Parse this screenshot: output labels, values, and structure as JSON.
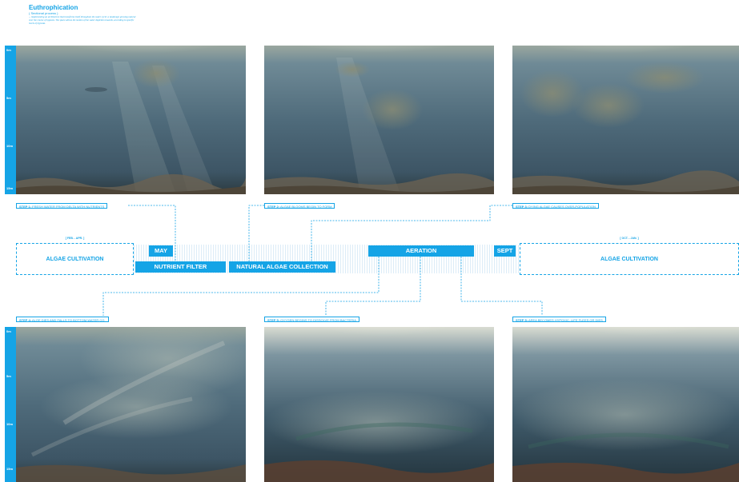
{
  "header": {
    "title": "Euthrophication",
    "subtitle": "( Sectional process )",
    "description": "... implementing an architecture that transforms itself throughout the water cycle: a landscape growing natural over the course of hypoxia. The space allows the motion of the water depletion towards, according to specific levels of hypoxia."
  },
  "depth_labels": [
    "0m",
    "5m",
    "10m",
    "15m"
  ],
  "steps_top": [
    {
      "num": "STEP 1:",
      "text": "FRESH WATER FROM DELTA WITH NUTRIENTS"
    },
    {
      "num": "STEP 2:",
      "text": "ALGAE BLOOMS BEGIN TO FORM"
    },
    {
      "num": "STEP 3:",
      "text": "DYING ALGAE CAUSES OVER-POPULATION"
    }
  ],
  "steps_bottom": [
    {
      "num": "STEP 4:",
      "text": "ALGE DIES AND FALLS TO BOTTOM WATER CO."
    },
    {
      "num": "STEP 5:",
      "text": "OXYGEN BEGINS TO DISSOLVE FROM BACTERIA"
    },
    {
      "num": "STEP 5:",
      "text": "AREA BECOMES HYPOXIC, LIFE FLEES OR DIES"
    }
  ],
  "timeline": {
    "left_range": "[ FEB. - APR. ]",
    "left_label": "ALGAE CULTIVATION",
    "may": "MAY",
    "nutrient_filter": "NUTRIENT FILTER",
    "natural_collection": "NATURAL ALGAE COLLECTION",
    "aeration": "AERATION",
    "sept": "SEPT",
    "right_range": "[ OCT. - JAN. ]",
    "right_label": "ALGAE CULTIVATION"
  },
  "colors": {
    "accent": "#15a4e6",
    "water_deep": "#2f4654",
    "water_mid": "#5b7585",
    "water_light": "#c7cfc8"
  }
}
